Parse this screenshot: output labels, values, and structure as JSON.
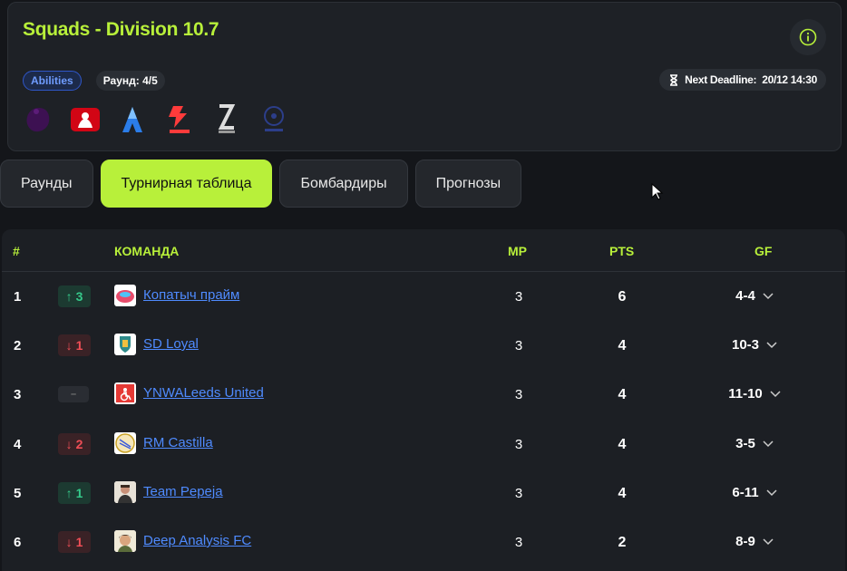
{
  "header": {
    "title": "Squads - Division 10.7",
    "abilities_label": "Abilities",
    "round_label": "Раунд: 4/5",
    "deadline_label": "Next Deadline:",
    "deadline_value": "20/12 14:30",
    "leagues": [
      "premier-league-icon",
      "bundesliga-icon",
      "ligue1-icon",
      "laliga-icon",
      "serie-a-icon",
      "champions-league-icon"
    ],
    "accent_color": "#b8f03a"
  },
  "tabs": [
    {
      "label": "Раунды",
      "active": false
    },
    {
      "label": "Турнирная таблица",
      "active": true
    },
    {
      "label": "Бомбардиры",
      "active": false
    },
    {
      "label": "Прогнозы",
      "active": false
    }
  ],
  "table": {
    "columns": {
      "pos": "#",
      "team": "КОМАНДА",
      "mp": "MP",
      "pts": "PTS",
      "gf": "GF"
    },
    "rows": [
      {
        "pos": "1",
        "change_dir": "up",
        "change": "3",
        "team": "Копатыч прайм",
        "mp": "3",
        "pts": "6",
        "gf": "4-4"
      },
      {
        "pos": "2",
        "change_dir": "down",
        "change": "1",
        "team": "SD Loyal",
        "mp": "3",
        "pts": "4",
        "gf": "10-3"
      },
      {
        "pos": "3",
        "change_dir": "same",
        "change": "–",
        "team": "YNWALeeds United",
        "mp": "3",
        "pts": "4",
        "gf": "11-10"
      },
      {
        "pos": "4",
        "change_dir": "down",
        "change": "2",
        "team": "RM Castilla",
        "mp": "3",
        "pts": "4",
        "gf": "3-5"
      },
      {
        "pos": "5",
        "change_dir": "up",
        "change": "1",
        "team": "Team Pepeja",
        "mp": "3",
        "pts": "4",
        "gf": "6-11"
      },
      {
        "pos": "6",
        "change_dir": "down",
        "change": "1",
        "team": "Deep Analysis FC",
        "mp": "3",
        "pts": "2",
        "gf": "8-9"
      }
    ]
  }
}
